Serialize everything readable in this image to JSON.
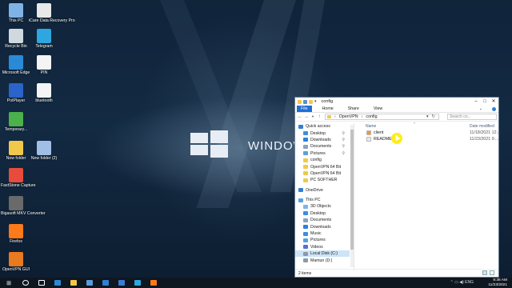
{
  "wallpaper": {
    "brand_text": "WINDOWS"
  },
  "desktop_icons": [
    {
      "label": "This PC",
      "icon": "this-pc-icon",
      "color": "#7fb3e6"
    },
    {
      "label": "iCare Data Recovery Pro",
      "icon": "icare-icon",
      "color": "#e8e8e8"
    },
    {
      "label": "Recycle Bin",
      "icon": "recycle-bin-icon",
      "color": "#d0d8e0"
    },
    {
      "label": "Telegram",
      "icon": "telegram-icon",
      "color": "#2ea6e0"
    },
    {
      "label": "Microsoft Edge",
      "icon": "edge-icon",
      "color": "#2a8ad8"
    },
    {
      "label": "PIN",
      "icon": "text-file-icon",
      "color": "#f4f4f4"
    },
    {
      "label": "PotPlayer",
      "icon": "potplayer-icon",
      "color": "#2a63c9"
    },
    {
      "label": "bluetooth",
      "icon": "text-file-icon",
      "color": "#f4f4f4"
    },
    {
      "label": "Temporary...",
      "icon": "temporary-icon",
      "color": "#4bb14b"
    },
    {
      "label": "New folder",
      "icon": "folder-icon",
      "color": "#f2c84b"
    },
    {
      "label": "New folder (2)",
      "icon": "folder-icon",
      "color": "#9fbfe6"
    },
    {
      "label": "FastStone Capture",
      "icon": "faststone-icon",
      "color": "#e84b3c"
    },
    {
      "label": "Bigasoft MKV Converter",
      "icon": "bigasoft-icon",
      "color": "#6a6a6a"
    },
    {
      "label": "Firefox",
      "icon": "firefox-icon",
      "color": "#ff7a1a"
    },
    {
      "label": "OpenVPN GUI",
      "icon": "openvpn-icon",
      "color": "#ea7a1f"
    }
  ],
  "explorer": {
    "title": "config",
    "ribbon_tabs": [
      "File",
      "Home",
      "Share",
      "View"
    ],
    "breadcrumb": [
      "OpenVPN",
      "config"
    ],
    "search_placeholder": "Search co...",
    "column_name": "Name",
    "column_date": "Date modified",
    "files": [
      {
        "name": "client",
        "date": "11/18/2021 12:...",
        "icon": "ovpn-config-icon",
        "color": "#f29a2e"
      },
      {
        "name": "README",
        "date": "11/23/2021 9:...",
        "icon": "text-file-icon",
        "color": "#e9e9e9"
      }
    ],
    "nav_items": [
      {
        "label": "Quick access",
        "icon": "star-icon",
        "color": "#2f7fd6",
        "indent": 0,
        "pinned": false
      },
      {
        "label": "Desktop",
        "icon": "desktop-icon",
        "color": "#3d8ee0",
        "indent": 1,
        "pinned": true
      },
      {
        "label": "Downloads",
        "icon": "downloads-icon",
        "color": "#2f7fd6",
        "indent": 1,
        "pinned": true
      },
      {
        "label": "Documents",
        "icon": "documents-icon",
        "color": "#8aa2bd",
        "indent": 1,
        "pinned": true
      },
      {
        "label": "Pictures",
        "icon": "pictures-icon",
        "color": "#5aa0e0",
        "indent": 1,
        "pinned": true
      },
      {
        "label": "config",
        "icon": "folder-icon",
        "color": "#f2c84b",
        "indent": 1,
        "pinned": false
      },
      {
        "label": "OpenVPN 64 Bit",
        "icon": "folder-icon",
        "color": "#f2c84b",
        "indent": 1,
        "pinned": false
      },
      {
        "label": "OpenVPN 64 Bit",
        "icon": "folder-icon",
        "color": "#f2c84b",
        "indent": 1,
        "pinned": false
      },
      {
        "label": "PC SOFTHER",
        "icon": "folder-icon",
        "color": "#f2c84b",
        "indent": 1,
        "pinned": false
      },
      {
        "label": "",
        "icon": "",
        "color": "",
        "indent": 0,
        "pinned": false
      },
      {
        "label": "OneDrive",
        "icon": "onedrive-icon",
        "color": "#2f7fd6",
        "indent": 0,
        "pinned": false
      },
      {
        "label": "",
        "icon": "",
        "color": "",
        "indent": 0,
        "pinned": false
      },
      {
        "label": "This PC",
        "icon": "this-pc-icon",
        "color": "#5aa0e0",
        "indent": 0,
        "pinned": false
      },
      {
        "label": "3D Objects",
        "icon": "3d-objects-icon",
        "color": "#7fb3e6",
        "indent": 1,
        "pinned": false
      },
      {
        "label": "Desktop",
        "icon": "desktop-icon",
        "color": "#3d8ee0",
        "indent": 1,
        "pinned": false
      },
      {
        "label": "Documents",
        "icon": "documents-icon",
        "color": "#8aa2bd",
        "indent": 1,
        "pinned": false
      },
      {
        "label": "Downloads",
        "icon": "downloads-icon",
        "color": "#2f7fd6",
        "indent": 1,
        "pinned": false
      },
      {
        "label": "Music",
        "icon": "music-icon",
        "color": "#3d8ee0",
        "indent": 1,
        "pinned": false
      },
      {
        "label": "Pictures",
        "icon": "pictures-icon",
        "color": "#5aa0e0",
        "indent": 1,
        "pinned": false
      },
      {
        "label": "Videos",
        "icon": "videos-icon",
        "color": "#5a6fd0",
        "indent": 1,
        "pinned": false
      },
      {
        "label": "Local Disk (C:)",
        "icon": "drive-icon",
        "color": "#8a9aab",
        "indent": 1,
        "pinned": false,
        "selected": true
      },
      {
        "label": "Mamun (D:)",
        "icon": "drive-icon",
        "color": "#8a9aab",
        "indent": 1,
        "pinned": false
      }
    ],
    "status_text": "2 items"
  },
  "taskbar": {
    "items": [
      {
        "icon": "search-icon",
        "color": "#ffffff"
      },
      {
        "icon": "task-view-icon",
        "color": "#ffffff"
      },
      {
        "icon": "edge-icon",
        "color": "#2a8ad8"
      },
      {
        "icon": "file-explorer-icon",
        "color": "#f2c84b"
      },
      {
        "icon": "store-icon",
        "color": "#5a9bd8"
      },
      {
        "icon": "mail-icon",
        "color": "#2f7fd6"
      },
      {
        "icon": "photoshop-icon",
        "color": "#3a7bd5"
      },
      {
        "icon": "telegram-icon",
        "color": "#2ea6e0"
      },
      {
        "icon": "firefox-icon",
        "color": "#ff7a1a"
      }
    ],
    "time": "9:36 AM",
    "date": "11/23/2021"
  }
}
